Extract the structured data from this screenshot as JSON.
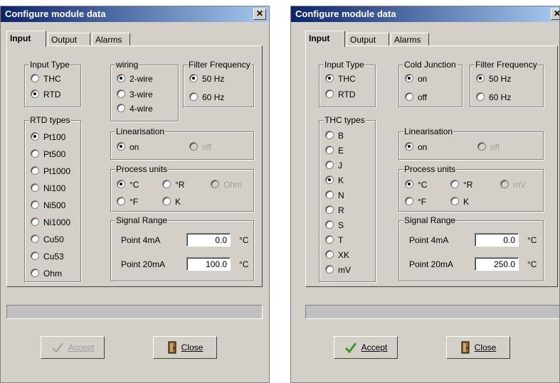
{
  "left": {
    "title": "Configure module data",
    "close_x": "✕",
    "tabs": [
      "Input",
      "Output",
      "Alarms"
    ],
    "input_type": {
      "title": "Input Type",
      "options": [
        "THC",
        "RTD"
      ],
      "selected": 1
    },
    "wiring": {
      "title": "wiring",
      "options": [
        "2-wire",
        "3-wire",
        "4-wire"
      ],
      "selected": 0
    },
    "filter": {
      "title": "Filter Frequency",
      "options": [
        "50 Hz",
        "60 Hz"
      ],
      "selected": 0
    },
    "types": {
      "title": "RTD types",
      "options": [
        "Pt100",
        "Pt500",
        "Pt1000",
        "Ni100",
        "Ni500",
        "Ni1000",
        "Cu50",
        "Cu53",
        "Ohm"
      ],
      "selected": 0
    },
    "linearisation": {
      "title": "Linearisation",
      "on": "on",
      "off": "off"
    },
    "process_units": {
      "title": "Process units",
      "options": [
        "°C",
        "°R",
        "Ohm",
        "°F",
        "K"
      ]
    },
    "signal_range": {
      "title": "Signal Range",
      "p4_label": "Point 4mA",
      "p4_value": "0.0",
      "p20_label": "Point 20mA",
      "p20_value": "100.0",
      "unit": "°C"
    },
    "accept_label": "Accept",
    "close_label": "Close"
  },
  "right": {
    "title": "Configure module data",
    "close_x": "✕",
    "tabs": [
      "Input",
      "Output",
      "Alarms"
    ],
    "input_type": {
      "title": "Input Type",
      "options": [
        "THC",
        "RTD"
      ],
      "selected": 0
    },
    "cold_junction": {
      "title": "Cold Junction",
      "options": [
        "on",
        "off"
      ],
      "selected": 0
    },
    "filter": {
      "title": "Filter Frequency",
      "options": [
        "50 Hz",
        "60 Hz"
      ],
      "selected": 0
    },
    "types": {
      "title": "THC types",
      "options": [
        "B",
        "E",
        "J",
        "K",
        "N",
        "R",
        "S",
        "T",
        "XK",
        "mV"
      ],
      "selected": 3
    },
    "linearisation": {
      "title": "Linearisation",
      "on": "on",
      "off": "off"
    },
    "process_units": {
      "title": "Process units",
      "options": [
        "°C",
        "°R",
        "mV",
        "°F",
        "K"
      ]
    },
    "signal_range": {
      "title": "Signal Range",
      "p4_label": "Point 4mA",
      "p4_value": "0.0",
      "p20_label": "Point 20mA",
      "p20_value": "250.0",
      "unit": "°C"
    },
    "accept_label": "Accept",
    "close_label": "Close"
  },
  "colors": {
    "titlebar_start": "#0a246a",
    "titlebar_end": "#a6caf0",
    "face": "#d4d0c8",
    "accept_check": "#2a9a2a"
  }
}
